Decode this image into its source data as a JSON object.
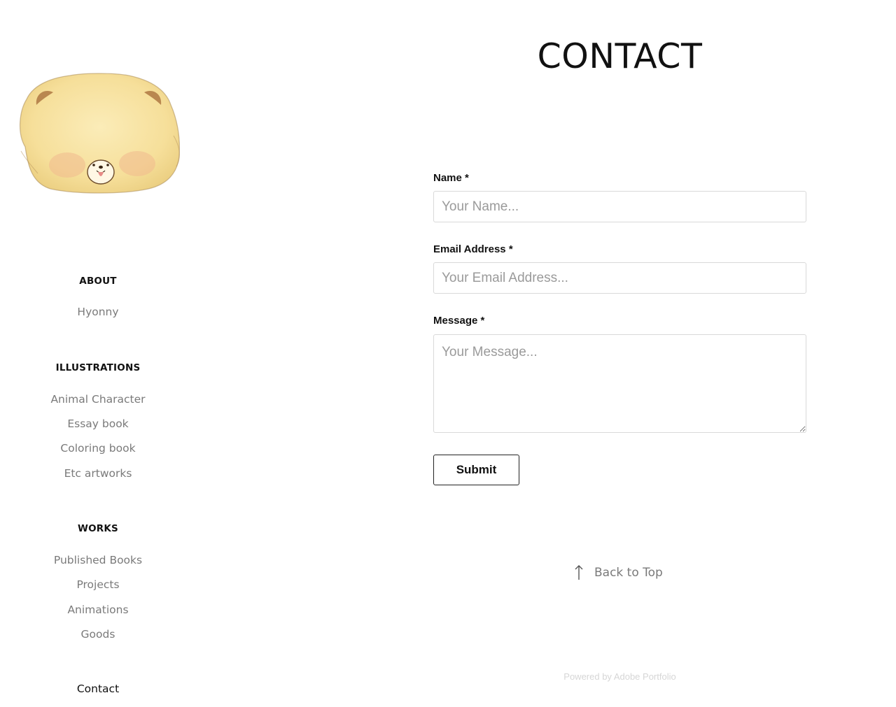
{
  "sidebar": {
    "logo": {
      "icon": "bear-face-logo"
    },
    "sections": [
      {
        "heading": "ABOUT",
        "links": [
          "Hyonny"
        ]
      },
      {
        "heading": "ILLUSTRATIONS",
        "links": [
          "Animal Character",
          "Essay book",
          "Coloring book",
          "Etc artworks"
        ]
      },
      {
        "heading": "WORKS",
        "links": [
          "Published Books",
          "Projects",
          "Animations",
          "Goods"
        ]
      }
    ],
    "contact_link": "Contact"
  },
  "main": {
    "title": "CONTACT",
    "form": {
      "name": {
        "label": "Name *",
        "placeholder": "Your Name...",
        "value": ""
      },
      "email": {
        "label": "Email Address *",
        "placeholder": "Your Email Address...",
        "value": ""
      },
      "message": {
        "label": "Message *",
        "placeholder": "Your Message...",
        "value": ""
      },
      "submit_label": "Submit"
    },
    "back_to_top": {
      "icon": "arrow-up-icon",
      "label": "Back to Top"
    },
    "footer": {
      "powered_by": "Powered by Adobe Portfolio"
    }
  },
  "colors": {
    "text_primary": "#111111",
    "nav_link": "#7a7a7a",
    "input_border": "#d9d9d9",
    "placeholder": "#9a9a9a",
    "footer_text": "#d6d6d6",
    "bear_fur": "#f7e2a0",
    "bear_ear": "#b9874f"
  }
}
